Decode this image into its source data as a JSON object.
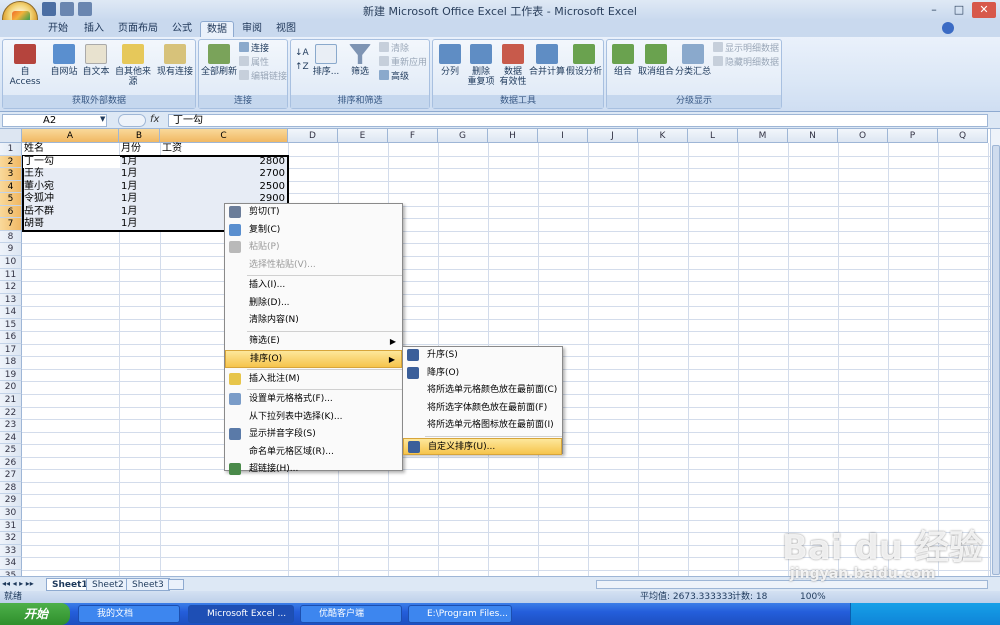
{
  "window": {
    "title": "新建 Microsoft Office Excel 工作表 - Microsoft Excel"
  },
  "tabs": [
    "开始",
    "插入",
    "页面布局",
    "公式",
    "数据",
    "审阅",
    "视图"
  ],
  "ribbon": {
    "groups": [
      {
        "label": "获取外部数据",
        "buttons": [
          "自 Access",
          "自网站",
          "自文本",
          "自其他来源",
          "现有连接"
        ]
      },
      {
        "label": "连接",
        "big": "全部刷新",
        "small": [
          "连接",
          "属性",
          "编辑链接"
        ]
      },
      {
        "label": "排序和筛选",
        "big": [
          "排序...",
          "筛选"
        ],
        "small": [
          "清除",
          "重新应用",
          "高级"
        ]
      },
      {
        "label": "数据工具",
        "buttons": [
          "分列",
          "删除\n重复项",
          "数据\n有效性",
          "合并计算",
          "假设分析"
        ]
      },
      {
        "label": "分级显示",
        "big": [
          "组合",
          "取消组合",
          "分类汇总"
        ],
        "small": [
          "显示明细数据",
          "隐藏明细数据"
        ]
      }
    ]
  },
  "formula_bar": {
    "name_box": "A2",
    "fx": "fx",
    "value": "丁一勾"
  },
  "columns": [
    "A",
    "B",
    "C",
    "D",
    "E",
    "F",
    "G",
    "H",
    "I",
    "J",
    "K",
    "L",
    "M",
    "N",
    "O",
    "P",
    "Q"
  ],
  "rows": [
    "1",
    "2",
    "3",
    "4",
    "5",
    "6",
    "7",
    "8",
    "9",
    "10",
    "11",
    "12",
    "13",
    "14",
    "15",
    "16",
    "17",
    "18",
    "19",
    "20",
    "21",
    "22",
    "23",
    "24",
    "25",
    "26",
    "27",
    "28",
    "29",
    "30",
    "31",
    "32",
    "33",
    "34",
    "35",
    "36"
  ],
  "table": {
    "headers": [
      "姓名",
      "月份",
      "工资"
    ],
    "data": [
      [
        "丁一勾",
        "1月",
        "2800"
      ],
      [
        "王东",
        "1月",
        "2700"
      ],
      [
        "董小宛",
        "1月",
        "2500"
      ],
      [
        "令狐冲",
        "1月",
        "2900"
      ],
      [
        "岳不群",
        "1月",
        ""
      ],
      [
        "胡哥",
        "1月",
        ""
      ]
    ]
  },
  "context_menu": [
    {
      "label": "剪切(T)",
      "icon": "scissors-icon",
      "disabled": false
    },
    {
      "label": "复制(C)",
      "icon": "copy-icon",
      "disabled": false
    },
    {
      "label": "粘贴(P)",
      "icon": "paste-icon",
      "disabled": true
    },
    {
      "label": "选择性粘贴(V)...",
      "disabled": true
    },
    {
      "sep": true
    },
    {
      "label": "插入(I)...",
      "disabled": false
    },
    {
      "label": "删除(D)...",
      "disabled": false
    },
    {
      "label": "清除内容(N)",
      "disabled": false
    },
    {
      "sep": true
    },
    {
      "label": "筛选(E)",
      "submenu": true
    },
    {
      "label": "排序(O)",
      "submenu": true,
      "highlight": true
    },
    {
      "sep": true
    },
    {
      "label": "插入批注(M)",
      "icon": "comment-icon"
    },
    {
      "sep": true
    },
    {
      "label": "设置单元格格式(F)...",
      "icon": "format-icon"
    },
    {
      "label": "从下拉列表中选择(K)..."
    },
    {
      "label": "显示拼音字段(S)",
      "icon": "phonetic-icon"
    },
    {
      "label": "命名单元格区域(R)..."
    },
    {
      "label": "超链接(H)...",
      "icon": "hyperlink-icon"
    }
  ],
  "sort_submenu": [
    {
      "label": "升序(S)",
      "icon": "sort-asc-icon"
    },
    {
      "label": "降序(O)",
      "icon": "sort-desc-icon"
    },
    {
      "label": "将所选单元格颜色放在最前面(C)"
    },
    {
      "label": "将所选字体颜色放在最前面(F)"
    },
    {
      "label": "将所选单元格图标放在最前面(I)"
    },
    {
      "sep": true
    },
    {
      "label": "自定义排序(U)...",
      "icon": "custom-sort-icon",
      "highlight": true
    }
  ],
  "sheets": [
    "Sheet1",
    "Sheet2",
    "Sheet3"
  ],
  "status": {
    "left": "就绪",
    "average": "平均值: 2673.333333",
    "count": "计数: 18",
    "zoom": "100%"
  },
  "taskbar": {
    "start": "开始",
    "items": [
      "我的文档",
      "Microsoft Excel ...",
      "优酷客户端",
      "E:\\Program Files..."
    ],
    "clock": ""
  },
  "watermark": {
    "brand": "Bai du 经验",
    "url": "jingyan.baidu.com"
  }
}
